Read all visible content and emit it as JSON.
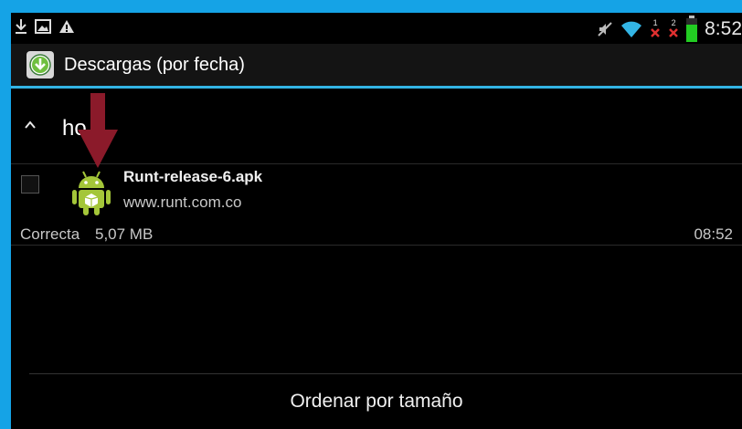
{
  "status_bar": {
    "left_icons": [
      "download-icon",
      "image-icon",
      "warning-icon"
    ],
    "right_icons": [
      "mute-icon",
      "wifi-icon",
      "sim1-no-signal-icon",
      "sim2-no-signal-icon",
      "battery-icon"
    ],
    "sim1_label": "1",
    "sim2_label": "2",
    "battery_level": 0.75,
    "time": "8:52"
  },
  "action_bar": {
    "title": "Descargas (por fecha)",
    "icon": "download-circle-icon"
  },
  "section": {
    "label": "ho",
    "icon": "chevron-up-icon"
  },
  "download": {
    "file_name": "Runt-release-6.apk",
    "source": "www.runt.com.co",
    "status": "Correcta",
    "size": "5,07 MB",
    "time": "08:52",
    "icon": "android-icon",
    "checked": false
  },
  "annotation": {
    "icon": "red-arrow-down-icon"
  },
  "footer": {
    "sort_button_label": "Ordenar por tamaño"
  },
  "colors": {
    "accent": "#33b5e5",
    "frame": "#15a3e6",
    "android_green": "#a4c639",
    "arrow_red": "#8b1a2a",
    "battery_green": "#22cc22",
    "no_signal_red": "#e03030"
  }
}
